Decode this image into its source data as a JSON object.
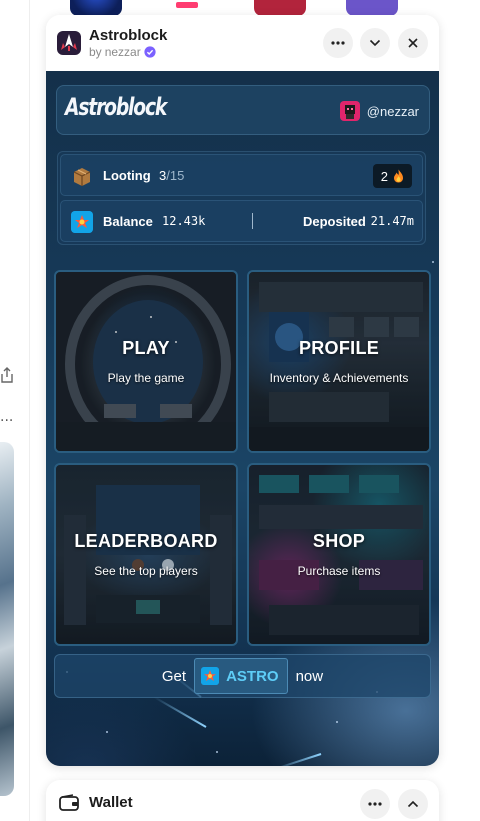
{
  "app": {
    "title": "Astroblock",
    "byline_prefix": "by",
    "author": "nezzar",
    "verified": true
  },
  "header_buttons": {
    "more": "more-icon",
    "collapse": "chevron-down-icon",
    "close": "close-icon"
  },
  "game": {
    "logo": "Astroblock",
    "user": "@nezzar",
    "looting": {
      "label": "Looting",
      "current": "3",
      "max": "/15",
      "streak": "2"
    },
    "balance": {
      "label": "Balance",
      "value": "12.43k",
      "deposited_label": "Deposited",
      "deposited_value": "21.47m"
    },
    "tiles": [
      {
        "title": "PLAY",
        "subtitle": "Play the game"
      },
      {
        "title": "PROFILE",
        "subtitle": "Inventory & Achievements"
      },
      {
        "title": "LEADERBOARD",
        "subtitle": "See the top players"
      },
      {
        "title": "SHOP",
        "subtitle": "Purchase items"
      }
    ],
    "cta": {
      "prefix": "Get",
      "token": "ASTRO",
      "suffix": "now"
    }
  },
  "wallet": {
    "title": "Wallet"
  },
  "colors": {
    "accent_cyan": "#5ecdf7",
    "tile_border": "#2a5d80",
    "game_bg": "#163a59",
    "verified": "#7b61ff"
  }
}
